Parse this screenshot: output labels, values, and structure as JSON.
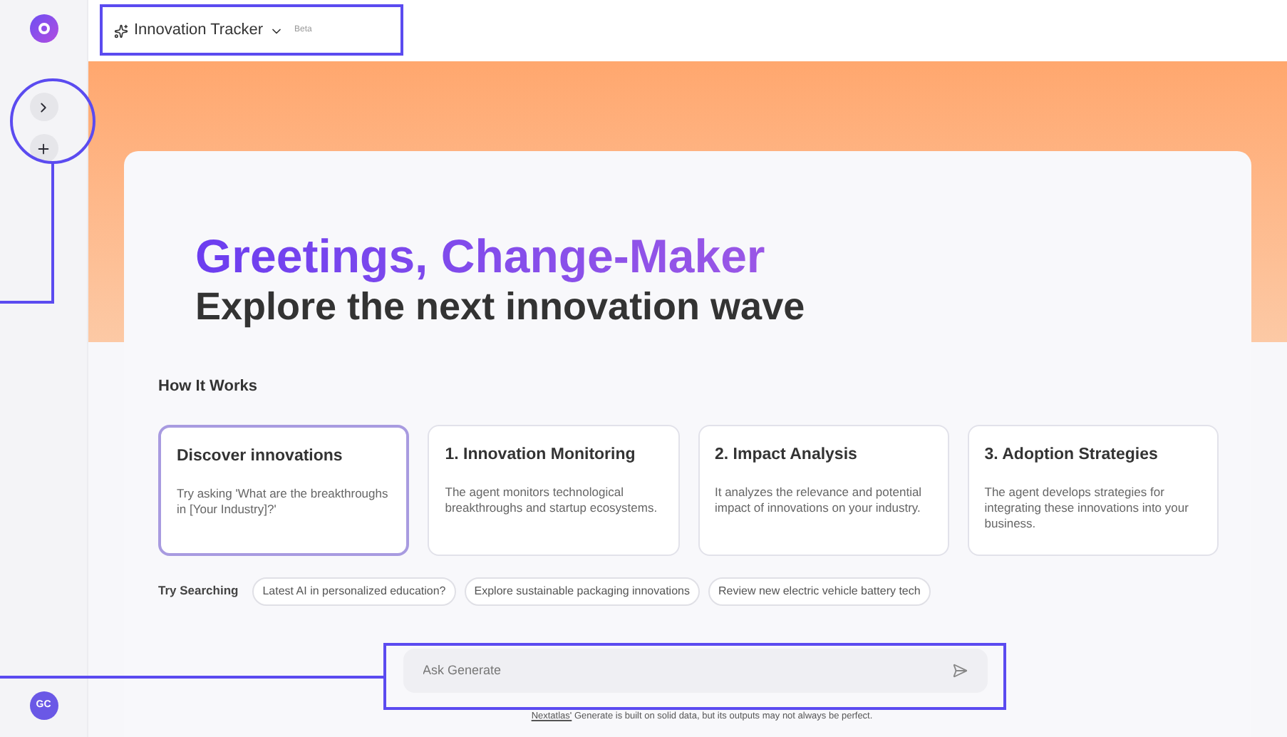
{
  "header": {
    "title": "Innovation Tracker",
    "badge": "Beta"
  },
  "avatar": {
    "initials": "GC"
  },
  "hero": {
    "title": "Greetings, Change-Maker",
    "subtitle": "Explore the next innovation wave"
  },
  "how_it_works": {
    "heading": "How It Works",
    "cards": [
      {
        "title": "Discover innovations",
        "body": "Try asking 'What are the breakthroughs in [Your Industry]?'",
        "selected": true
      },
      {
        "title": "1. Innovation Monitoring",
        "body": "The agent monitors technological breakthroughs and startup ecosystems.",
        "selected": false
      },
      {
        "title": "2. Impact Analysis",
        "body": "It analyzes the relevance and potential impact of innovations on your industry.",
        "selected": false
      },
      {
        "title": "3. Adoption Strategies",
        "body": "The agent develops strategies for integrating these innovations into your business.",
        "selected": false
      }
    ]
  },
  "suggestions": {
    "label": "Try Searching",
    "chips": [
      "Latest AI in personalized education?",
      "Explore sustainable packaging innovations",
      "Review new electric vehicle battery tech"
    ]
  },
  "prompt": {
    "placeholder": "Ask Generate"
  },
  "disclaimer": {
    "link": "Nextatlas'",
    "text": "Generate is built on solid data, but its outputs may not always be perfect."
  }
}
